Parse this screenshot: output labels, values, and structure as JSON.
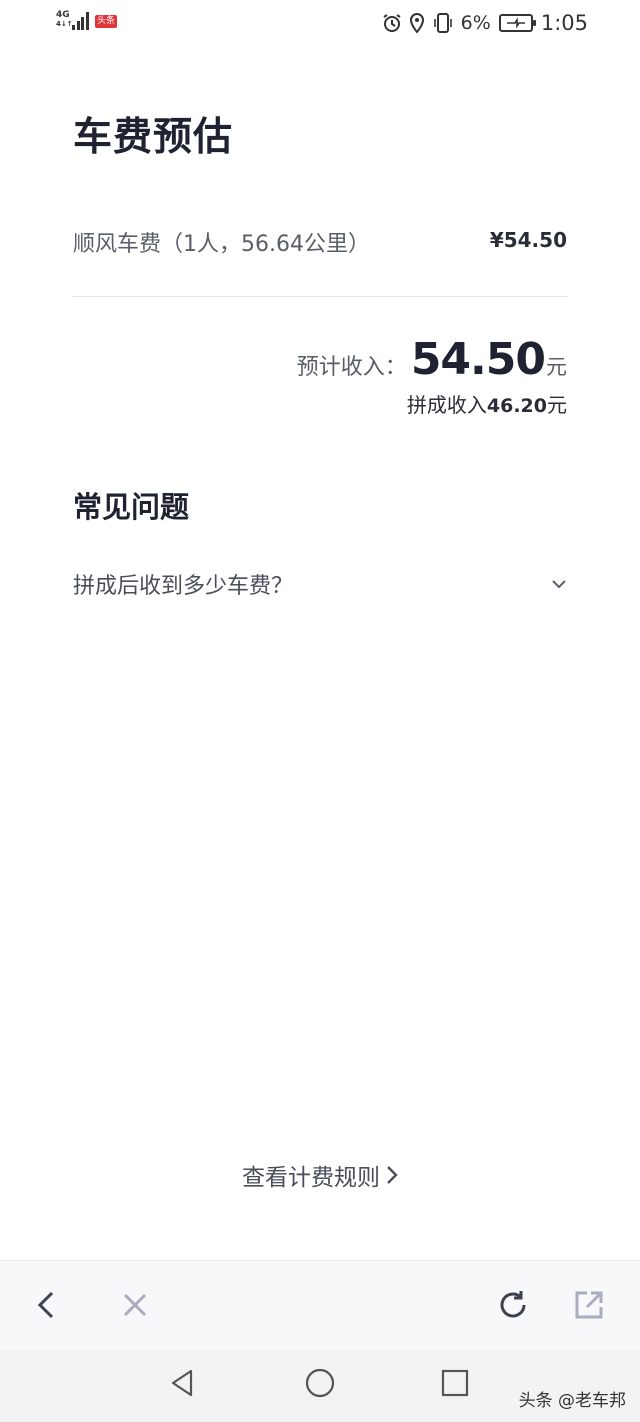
{
  "status_bar": {
    "network": "4G",
    "network_sub": "4↓↑",
    "app_badge": "头条",
    "battery_percent": "6%",
    "time": "1:05",
    "icons": [
      "signal-icon",
      "alarm-icon",
      "location-icon",
      "vibrate-icon",
      "battery-charging-icon"
    ]
  },
  "page": {
    "title": "车费预估"
  },
  "fare": {
    "label": "顺风车费（1人，56.64公里）",
    "amount": "¥54.50"
  },
  "income": {
    "label": "预计收入：",
    "value": "54.50",
    "unit": "元",
    "pool_label": "拼成收入",
    "pool_value": "46.20",
    "pool_unit": "元"
  },
  "faq": {
    "title": "常见问题",
    "items": [
      {
        "question": "拼成后收到多少车费？"
      }
    ]
  },
  "rules_link": {
    "label": "查看计费规则"
  },
  "toolbar": {
    "icons": [
      "back-icon",
      "close-icon",
      "refresh-icon",
      "share-icon"
    ]
  },
  "navbar": {
    "icons": [
      "nav-back-icon",
      "nav-home-icon",
      "nav-recents-icon"
    ]
  },
  "watermark": "头条 @老车邦",
  "colors": {
    "text_primary": "#1f2230",
    "text_secondary": "#5a5e6b",
    "divider": "#e3e4e8",
    "badge": "#e0343b"
  }
}
